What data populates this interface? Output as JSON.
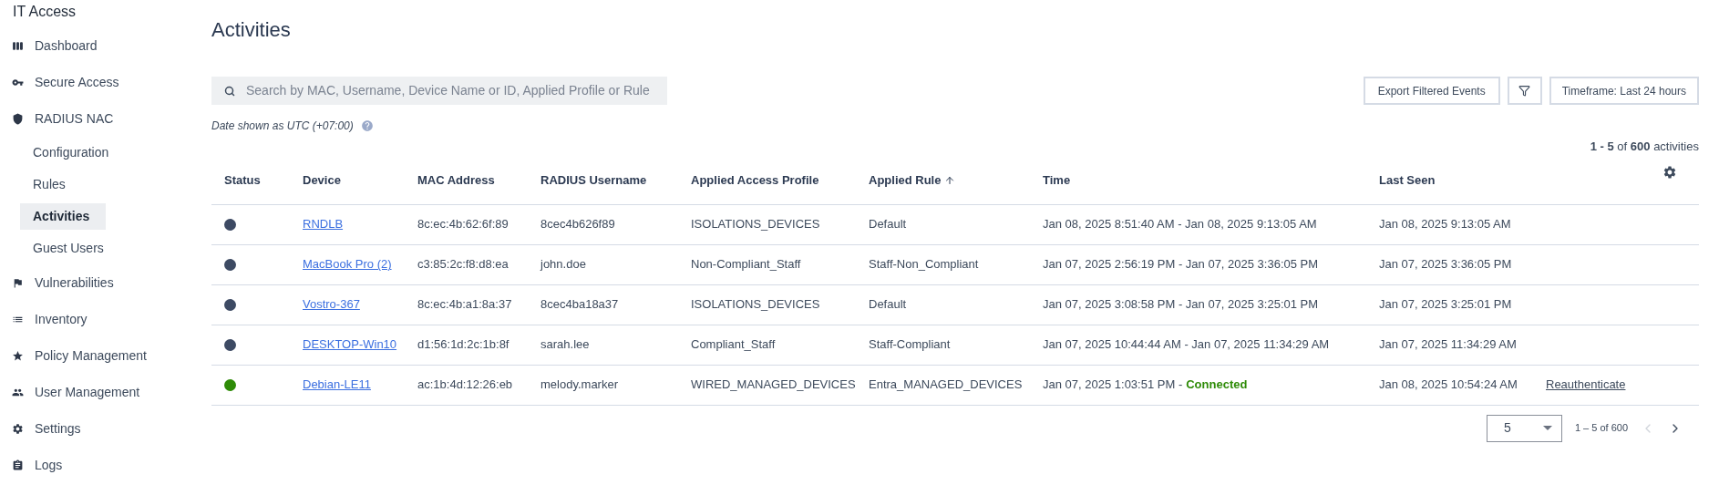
{
  "app": {
    "title": "IT Access"
  },
  "sidebar": {
    "items": [
      {
        "label": "Dashboard",
        "selected": false
      },
      {
        "label": "Secure Access",
        "selected": false
      },
      {
        "label": "RADIUS NAC",
        "selected": false,
        "children": [
          {
            "label": "Configuration",
            "selected": false
          },
          {
            "label": "Rules",
            "selected": false
          },
          {
            "label": "Activities",
            "selected": true
          },
          {
            "label": "Guest Users",
            "selected": false
          }
        ]
      },
      {
        "label": "Vulnerabilities",
        "selected": false
      },
      {
        "label": "Inventory",
        "selected": false
      },
      {
        "label": "Policy Management",
        "selected": false
      },
      {
        "label": "User Management",
        "selected": false
      },
      {
        "label": "Settings",
        "selected": false
      },
      {
        "label": "Logs",
        "selected": false
      }
    ]
  },
  "page": {
    "title": "Activities",
    "search": {
      "placeholder": "Search by MAC, Username, Device Name or ID, Applied Profile or Rule"
    },
    "buttons": {
      "export": "Export Filtered Events",
      "timeframe": "Timeframe: Last 24 hours"
    },
    "date_note": "Date shown as UTC (+07:00)",
    "count": "**1 - 5** of **600** activities"
  },
  "table": {
    "columns": [
      {
        "label": "Status",
        "sorted": false
      },
      {
        "label": "Device",
        "sorted": false
      },
      {
        "label": "MAC Address",
        "sorted": false
      },
      {
        "label": "RADIUS Username",
        "sorted": false
      },
      {
        "label": "Applied Access Profile",
        "sorted": false
      },
      {
        "label": "Applied Rule",
        "sorted": true
      },
      {
        "label": "Time",
        "sorted": false
      },
      {
        "label": "Last Seen",
        "sorted": false
      }
    ],
    "rows": [
      {
        "color": "#3d4a63",
        "device": "RNDLB",
        "mac": "8c:ec:4b:62:6f:89",
        "username": "8cec4b626f89",
        "profile": "ISOLATIONS_DEVICES",
        "rule": "Default",
        "time": "Jan 08, 2025 8:51:40 AM - Jan 08, 2025 9:13:05 AM",
        "last_seen": "Jan 08, 2025 9:13:05 AM"
      },
      {
        "color": "#3d4a63",
        "device": "MacBook Pro (2)",
        "mac": "c3:85:2c:f8:d8:ea",
        "username": "john.doe",
        "profile": "Non-Compliant_Staff",
        "rule": "Staff-Non_Compliant",
        "time": "Jan 07, 2025 2:56:19 PM - Jan 07, 2025 3:36:05 PM",
        "last_seen": "Jan 07, 2025 3:36:05 PM"
      },
      {
        "color": "#3d4a63",
        "device": "Vostro-367",
        "mac": "8c:ec:4b:a1:8a:37",
        "username": "8cec4ba18a37",
        "profile": "ISOLATIONS_DEVICES",
        "rule": "Default",
        "time": "Jan 07, 2025 3:08:58 PM - Jan 07, 2025 3:25:01 PM",
        "last_seen": "Jan 07, 2025 3:25:01 PM"
      },
      {
        "color": "#3d4a63",
        "device": "DESKTOP-Win10",
        "mac": "d1:56:1d:2c:1b:8f",
        "username": "sarah.lee",
        "profile": "Compliant_Staff",
        "rule": "Staff-Compliant",
        "time": "Jan 07, 2025 10:44:44 AM - Jan 07, 2025 11:34:29 AM",
        "last_seen": "Jan 07, 2025 11:34:29 AM"
      },
      {
        "color": "#2e8b07",
        "device": "Debian-LE11",
        "mac": "ac:1b:4d:12:26:eb",
        "username": "melody.marker",
        "profile": "WIRED_MANAGED_DEVICES",
        "rule": "Entra_MANAGED_DEVICES",
        "time": "Jan 07, 2025 1:03:51 PM -",
        "connection": "Connected",
        "last_seen": "Jan 08, 2025 10:54:24 AM",
        "action": "Reauthenticate"
      }
    ]
  },
  "pagination": {
    "page_size": "5",
    "range": "1 – 5 of 600",
    "prev": {
      "disabled": true
    },
    "next": {
      "disabled": false
    }
  }
}
